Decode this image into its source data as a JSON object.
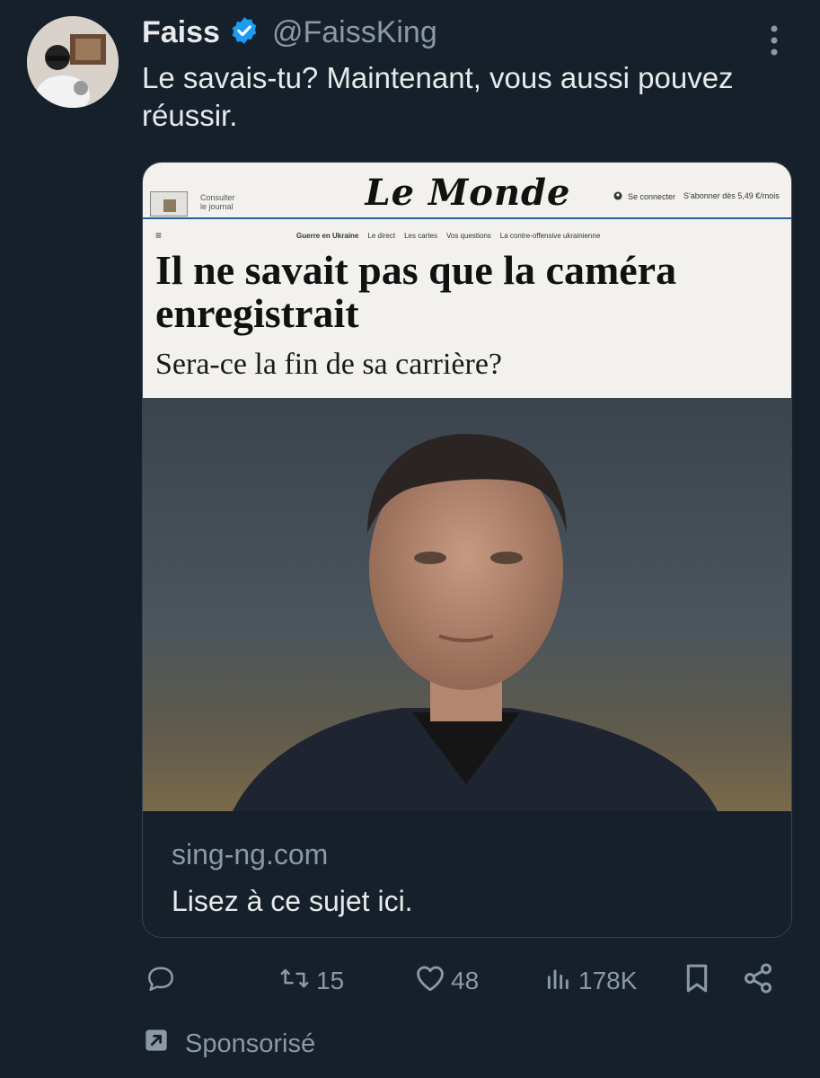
{
  "author": {
    "name": "Faiss",
    "handle": "@FaissKing",
    "verified_icon": "verified-badge-icon",
    "badge_color": "#1d9bf0"
  },
  "tweet": {
    "text": "Le savais-tu? Maintenant, vous aussi pouvez réussir."
  },
  "card": {
    "image": {
      "consult_line1": "Consulter",
      "consult_line2": "le journal",
      "logo": "Le Monde",
      "connect": "Se connecter",
      "subscribe": "S'abonner dès 5,49 €/mois",
      "nav": [
        "Guerre en Ukraine",
        "Le direct",
        "Les cartes",
        "Vos questions",
        "La contre-offensive ukrainienne"
      ],
      "headline": "Il ne savait pas que la caméra enregistrait",
      "subheadline": "Sera-ce la fin de sa carrière?"
    },
    "domain": "sing-ng.com",
    "title": "Lisez à ce sujet ici."
  },
  "actions": {
    "reply_icon": "reply-icon",
    "retweets": "15",
    "likes": "48",
    "views": "178K",
    "bookmark_icon": "bookmark-icon",
    "share_icon": "share-icon"
  },
  "sponsored": {
    "label": "Sponsorisé"
  },
  "colors": {
    "background": "#15202b",
    "text": "#e7e9ea",
    "muted": "#8b98a5",
    "border": "#38444d"
  }
}
